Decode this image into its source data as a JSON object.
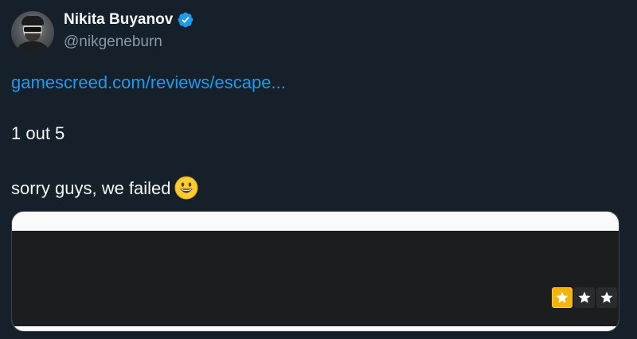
{
  "author": {
    "display_name": "Nikita Buyanov",
    "handle": "@nikgeneburn",
    "verified": true
  },
  "tweet": {
    "link_text": "gamescreed.com/reviews/escape...",
    "line1": "1 out 5",
    "line2": "sorry guys, we failed"
  },
  "card": {
    "rating": {
      "filled": 1,
      "shown": 3
    }
  },
  "colors": {
    "background": "#15202b",
    "link": "#1d9bf0",
    "verified": "#1d9bf0",
    "star_fill": "#f4b400"
  }
}
